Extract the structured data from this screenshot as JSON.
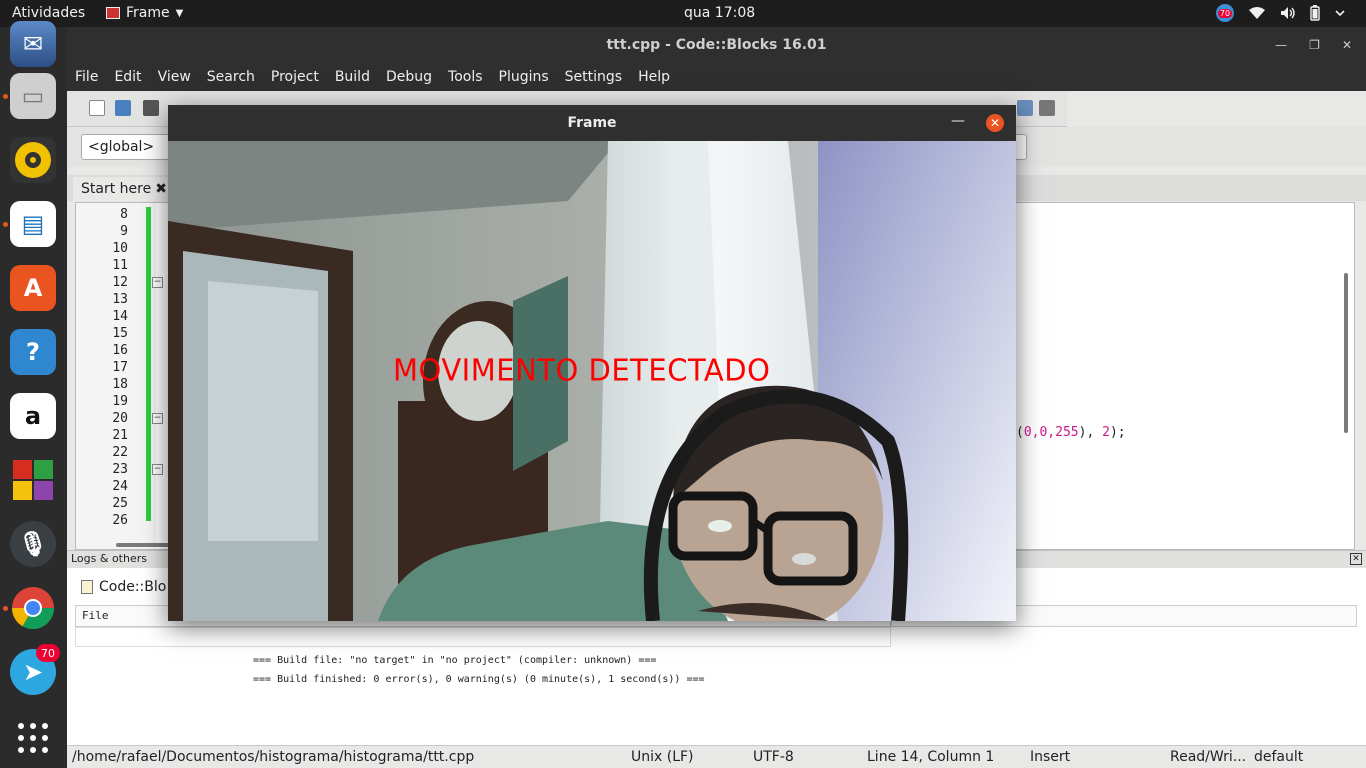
{
  "topbar": {
    "activities": "Atividades",
    "app_name": "Frame",
    "clock": "qua 17:08",
    "tray_badge": "70"
  },
  "dock": {
    "telegram_badge": "70",
    "apps": [
      "thunderbird",
      "files",
      "rhythmbox",
      "libreoffice-writer",
      "ubuntu-software",
      "help",
      "amazon",
      "game",
      "voice-recorder",
      "chrome",
      "telegram",
      "show-apps"
    ]
  },
  "codeblocks": {
    "title": "ttt.cpp - Code::Blocks 16.01",
    "menu": [
      "File",
      "Edit",
      "View",
      "Search",
      "Project",
      "Build",
      "Debug",
      "Tools",
      "Plugins",
      "Settings",
      "Help"
    ],
    "scope": "<global>",
    "tab_label": "Start here",
    "line_numbers": [
      "8",
      "9",
      "10",
      "11",
      "12",
      "13",
      "14",
      "15",
      "16",
      "17",
      "18",
      "19",
      "20",
      "21",
      "22",
      "23",
      "24",
      "25",
      "26"
    ],
    "visible_code": {
      "pre": "(",
      "args": "0,0,255",
      "mid": "), ",
      "num": "2",
      "end": ");"
    },
    "logs": {
      "header": "Logs & others",
      "tab": "Code::Blo",
      "column_file": "File",
      "lines": [
        "=== Build file: \"no target\" in \"no project\" (compiler: unknown) ===",
        "=== Build finished: 0 error(s), 0 warning(s) (0 minute(s), 1 second(s)) ==="
      ]
    },
    "status": {
      "path": "/home/rafael/Documentos/histograma/histograma/ttt.cpp",
      "eol": "Unix (LF)",
      "encoding": "UTF-8",
      "position": "Line 14, Column 1",
      "mode": "Insert",
      "access": "Read/Wri...",
      "profile": "default"
    }
  },
  "frame": {
    "title": "Frame",
    "overlay": "MOVIMENTO  DETECTADO"
  },
  "colors": {
    "accent": "#e95420",
    "overlay_text": "#ff0000",
    "change_bar": "#2ecc40"
  }
}
